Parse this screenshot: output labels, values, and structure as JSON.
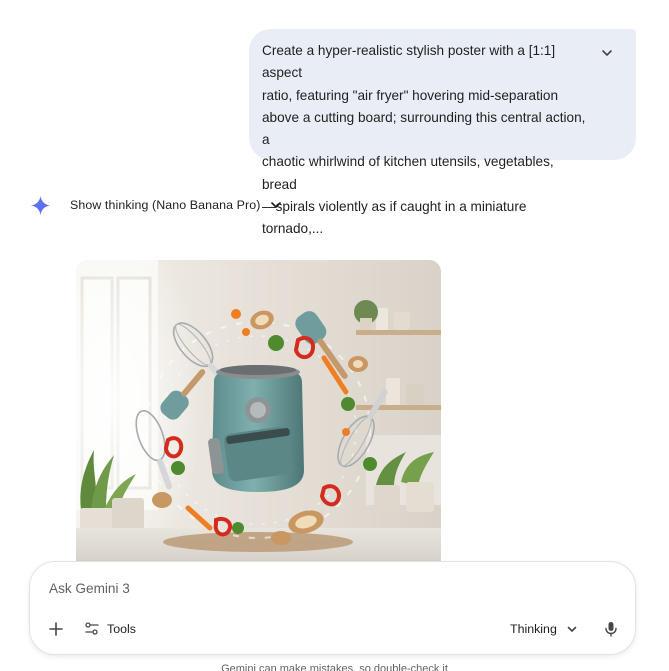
{
  "conversation": {
    "user_prompt": "Create a hyper-realistic stylish poster with a [1:1] aspect\nratio, featuring \"air fryer\" hovering mid-separation\nabove a cutting board; surrounding this central action, a\nchaotic whirlwind of kitchen utensils, vegetables, bread\n—spirals violently as if caught in a miniature tornado,..."
  },
  "response": {
    "thinking_label": "Show thinking (Nano Banana Pro)",
    "icon": "gemini-spark-icon"
  },
  "composer": {
    "placeholder": "Ask Gemini 3",
    "tools_label": "Tools",
    "mode_label": "Thinking"
  },
  "footer": {
    "disclaimer": "Gemini can make mistakes, so double-check it"
  },
  "colors": {
    "bubble_bg": "#e9eef6",
    "spark_blue": "#4285f4",
    "air_fryer_teal": "#6f9c9c"
  }
}
